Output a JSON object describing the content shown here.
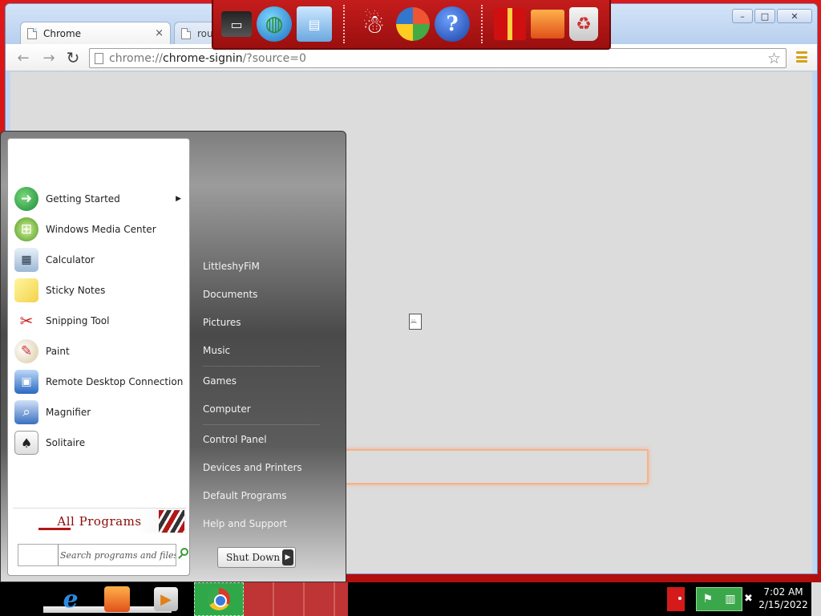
{
  "browser": {
    "tabs": [
      {
        "title": "Chrome"
      },
      {
        "title": "rout"
      }
    ],
    "tab_close_glyph": "×",
    "address": {
      "scheme": "chrome://",
      "host": "chrome-signin",
      "path": "/?source=0"
    },
    "window_buttons": {
      "minimize": "–",
      "maximize": "□",
      "close": "✕"
    },
    "nav": {
      "back": "←",
      "forward": "→",
      "reload": "↻"
    },
    "star": "☆",
    "icons": {
      "back": "back-arrow-icon",
      "forward": "forward-arrow-icon",
      "reload": "reload-icon",
      "star": "star-icon",
      "menu": "menu-icon"
    }
  },
  "launcher": {
    "icons": [
      "laptop-icon",
      "globe-icon",
      "network-icon",
      "snowman-icon",
      "windows-shield-icon",
      "help-icon",
      "gift-icon",
      "folder-icon",
      "recycle-bin-icon"
    ],
    "help_glyph": "?"
  },
  "start_menu": {
    "programs": [
      {
        "label": "Getting Started",
        "icon": "getting-started-icon",
        "glyph": "➜",
        "has_submenu": true
      },
      {
        "label": "Windows Media Center",
        "icon": "media-center-icon",
        "glyph": "⊞"
      },
      {
        "label": "Calculator",
        "icon": "calculator-icon",
        "glyph": "▦"
      },
      {
        "label": "Sticky Notes",
        "icon": "sticky-notes-icon",
        "glyph": "▭"
      },
      {
        "label": "Snipping Tool",
        "icon": "scissors-icon",
        "glyph": "✂"
      },
      {
        "label": "Paint",
        "icon": "paint-palette-icon",
        "glyph": "✎"
      },
      {
        "label": "Remote Desktop Connection",
        "icon": "remote-desktop-icon",
        "glyph": "▣"
      },
      {
        "label": "Magnifier",
        "icon": "magnifier-icon",
        "glyph": "⌕"
      },
      {
        "label": "Solitaire",
        "icon": "solitaire-icon",
        "glyph": "♠"
      }
    ],
    "submenu_arrow": "▶",
    "all_programs": "All Programs",
    "search_placeholder": "Search programs and files",
    "places_group1": [
      "LittleshyFiM",
      "Documents",
      "Pictures",
      "Music"
    ],
    "places_group2": [
      "Games",
      "Computer"
    ],
    "places_group3": [
      "Control Panel",
      "Devices and Printers",
      "Default Programs",
      "Help and Support"
    ],
    "shutdown_label": "Shut Down",
    "shutdown_arrow": "▶"
  },
  "taskbar": {
    "start_glyph": "☃",
    "ie_glyph": "e",
    "media_glyph": "▶",
    "tray_glyphs": [
      "⚑",
      "▥"
    ],
    "volume_glyph": "✖",
    "time": "7:02 AM",
    "date": "2/15/2022"
  },
  "colors": {
    "wallpaper": "#d21414",
    "chrome_frame": "#bfd7f5",
    "start_menu_dark": "#4a4a4a",
    "taskbar": "#000000",
    "tray_green": "#3aa84a"
  }
}
